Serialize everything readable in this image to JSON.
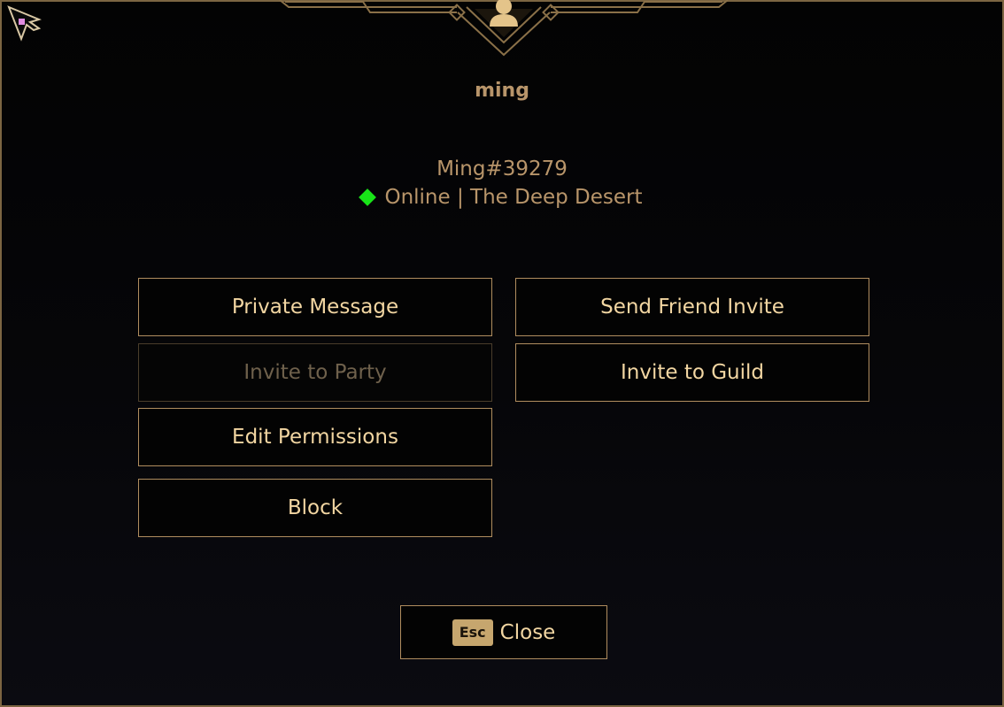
{
  "player": {
    "name": "ming",
    "tag": "Ming#39279",
    "status": "Online | The Deep Desert",
    "status_color": "#18e418"
  },
  "actions": {
    "private_message": "Private Message",
    "invite_party": "Invite to Party",
    "edit_permissions": "Edit Permissions",
    "block": "Block",
    "send_friend_invite": "Send Friend Invite",
    "invite_guild": "Invite to Guild"
  },
  "close": {
    "key": "Esc",
    "label": "Close"
  },
  "icons": {
    "cursor": "arrow-cursor-icon",
    "avatar": "player-silhouette-icon",
    "status": "online-diamond-icon"
  },
  "colors": {
    "accent": "#b08d5f",
    "text": "#f2d6a2",
    "disabled_text": "#6f614c",
    "background": "#060609"
  }
}
